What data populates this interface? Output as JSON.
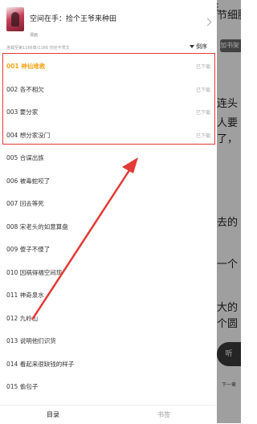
{
  "reader": {
    "top_icon": "☰",
    "shelf_tag": "加书架",
    "lines": [
      "节细腻",
      "",
      "连头",
      "人要",
      "了，",
      "",
      "",
      "去的",
      "",
      "一个",
      "",
      "大的",
      "个圆",
      ""
    ],
    "listen_label": "听",
    "next_label": "下一章"
  },
  "book": {
    "title": "空间在手：捡个王爷来种田",
    "author": "漫画",
    "meta": "连载至第1166章/1166 你还不赏文",
    "sort_label": "倒序"
  },
  "chapters": [
    {
      "title": "001 神仙难救",
      "status": "已下载",
      "active": true
    },
    {
      "title": "002 各不相欠",
      "status": "已下载",
      "active": false
    },
    {
      "title": "003 要分家",
      "status": "已下载",
      "active": false
    },
    {
      "title": "004 想分家没门",
      "status": "已下载",
      "active": false
    },
    {
      "title": "005 合谋出族",
      "status": "",
      "active": false
    },
    {
      "title": "006 被毒蛇咬了",
      "status": "",
      "active": false
    },
    {
      "title": "007 回去等死",
      "status": "",
      "active": false
    },
    {
      "title": "008 宋老头的如意算盘",
      "status": "",
      "active": false
    },
    {
      "title": "009 傻子不傻了",
      "status": "",
      "active": false
    },
    {
      "title": "010 因祸得福空间现",
      "status": "",
      "active": false
    },
    {
      "title": "011 神奇泉水",
      "status": "",
      "active": false
    },
    {
      "title": "012 九岭山",
      "status": "",
      "active": false
    },
    {
      "title": "013 说明他们识货",
      "status": "",
      "active": false
    },
    {
      "title": "014 看起来很缺钱的样子",
      "status": "",
      "active": false
    },
    {
      "title": "015 偷包子",
      "status": "",
      "active": false
    }
  ],
  "tabs": {
    "toc": "目录",
    "bookmarks": "书签"
  },
  "colors": {
    "active_chapter": "#f3a61d",
    "annotation": "#e23a34"
  }
}
